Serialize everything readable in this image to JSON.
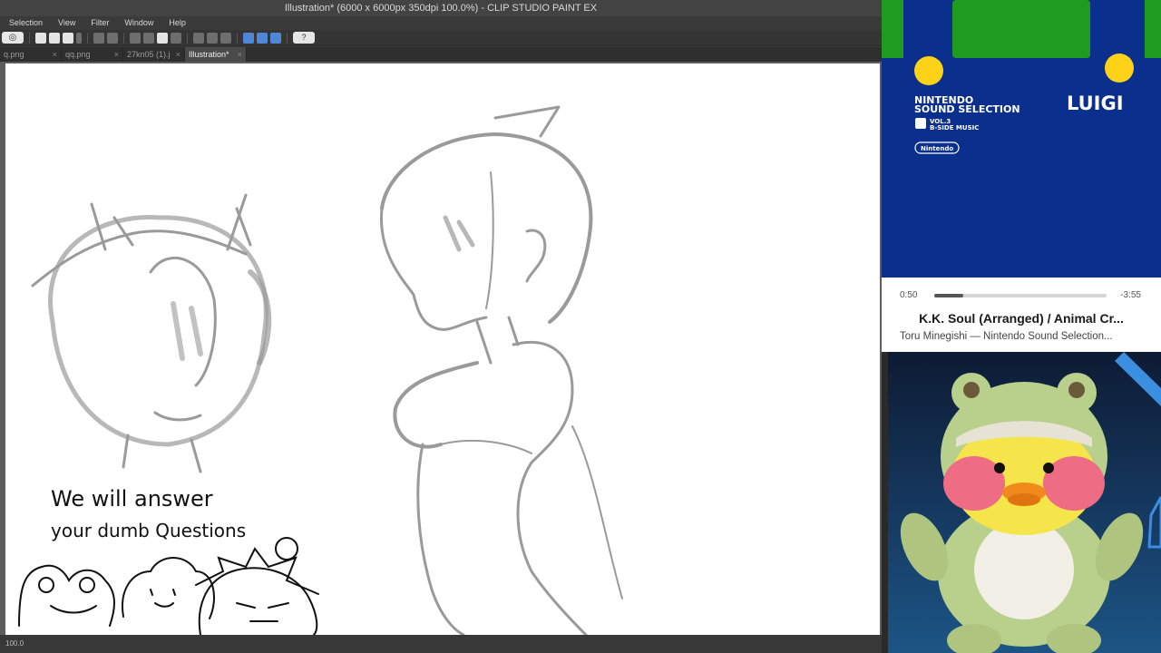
{
  "app": {
    "title": "Illustration* (6000 x 6000px 350dpi 100.0%) - CLIP STUDIO PAINT EX",
    "menu": [
      "Selection",
      "View",
      "Filter",
      "Window",
      "Help"
    ],
    "tabs": [
      {
        "label": "q.png",
        "active": false
      },
      {
        "label": "qq.png",
        "active": false
      },
      {
        "label": "27kn05 (1).j",
        "active": false
      },
      {
        "label": "Illustration*",
        "active": true
      }
    ],
    "tab_close_glyph": "×",
    "help_glyph": "?",
    "zoom": "100.0",
    "canvas_text": {
      "line1": "We will answer",
      "line2": "your dumb Questions"
    }
  },
  "player": {
    "album": {
      "brand_line1": "NINTENDO",
      "brand_line2": "SOUND SELECTION",
      "vol": "VOL.3",
      "vol_sub": "B-SIDE MUSIC",
      "publisher": "Nintendo",
      "character": "LUIGI",
      "colors": {
        "bg": "#0b2f8c",
        "green": "#1f9b1f",
        "yellow": "#ffd21a"
      }
    },
    "elapsed": "0:50",
    "remaining": "-3:55",
    "progress": 0.17,
    "track_title": "K.K. Soul (Arranged) / Animal Cr...",
    "track_subtitle": "Toru Minegishi — Nintendo Sound Selection..."
  },
  "colors": {
    "accent": "#4f86d6",
    "canvas": "#ffffff"
  }
}
